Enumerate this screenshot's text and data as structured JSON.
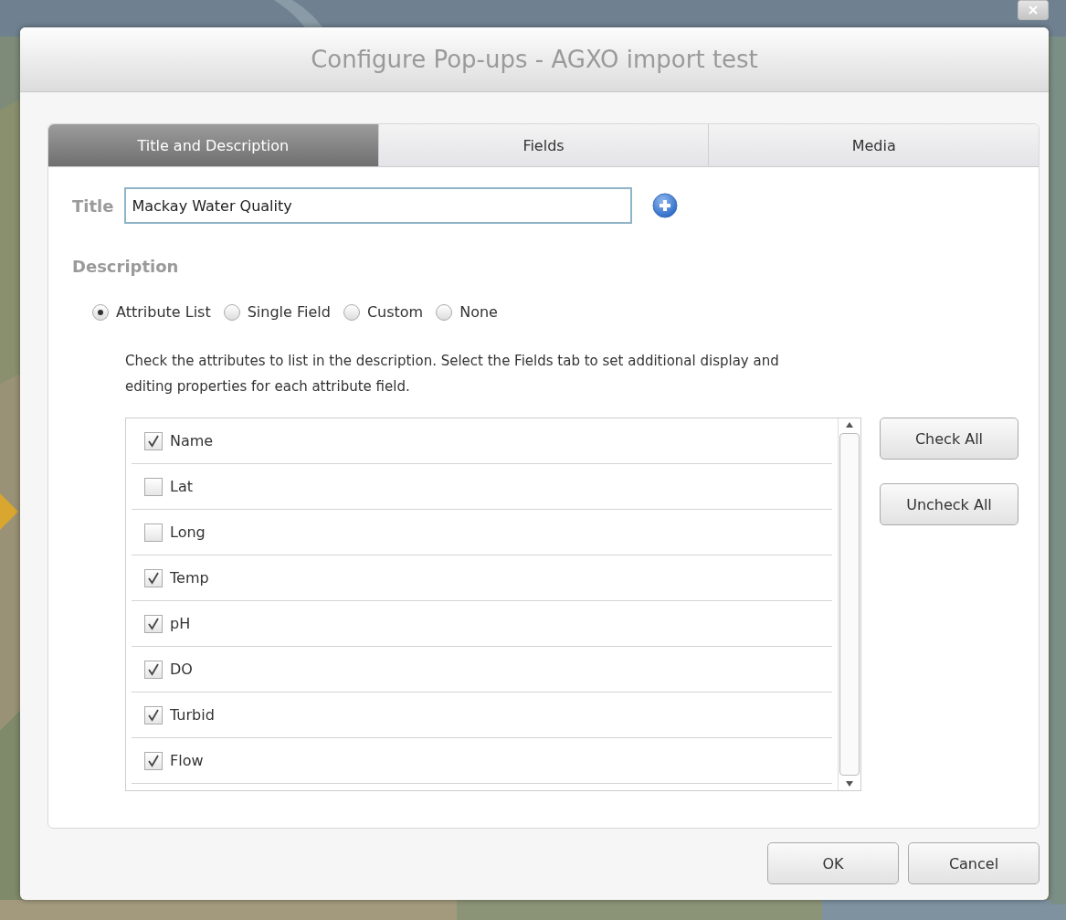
{
  "window": {
    "title": "Configure Pop-ups - AGXO import test"
  },
  "tabs": [
    {
      "label": "Title and Description",
      "selected": true
    },
    {
      "label": "Fields",
      "selected": false
    },
    {
      "label": "Media",
      "selected": false
    }
  ],
  "title_field": {
    "label": "Title",
    "value": "Mackay Water Quality"
  },
  "description": {
    "label": "Description",
    "options": [
      {
        "label": "Attribute List",
        "selected": true
      },
      {
        "label": "Single Field",
        "selected": false
      },
      {
        "label": "Custom",
        "selected": false
      },
      {
        "label": "None",
        "selected": false
      }
    ],
    "help": "Check the attributes to list in the description. Select the Fields tab to set additional display and editing properties for each attribute field."
  },
  "attributes": [
    {
      "name": "Name",
      "checked": true
    },
    {
      "name": "Lat",
      "checked": false
    },
    {
      "name": "Long",
      "checked": false
    },
    {
      "name": "Temp",
      "checked": true
    },
    {
      "name": "pH",
      "checked": true
    },
    {
      "name": "DO",
      "checked": true
    },
    {
      "name": "Turbid",
      "checked": true
    },
    {
      "name": "Flow",
      "checked": true
    }
  ],
  "list_buttons": [
    "Check All",
    "Uncheck All"
  ],
  "footer_buttons": [
    "OK",
    "Cancel"
  ]
}
